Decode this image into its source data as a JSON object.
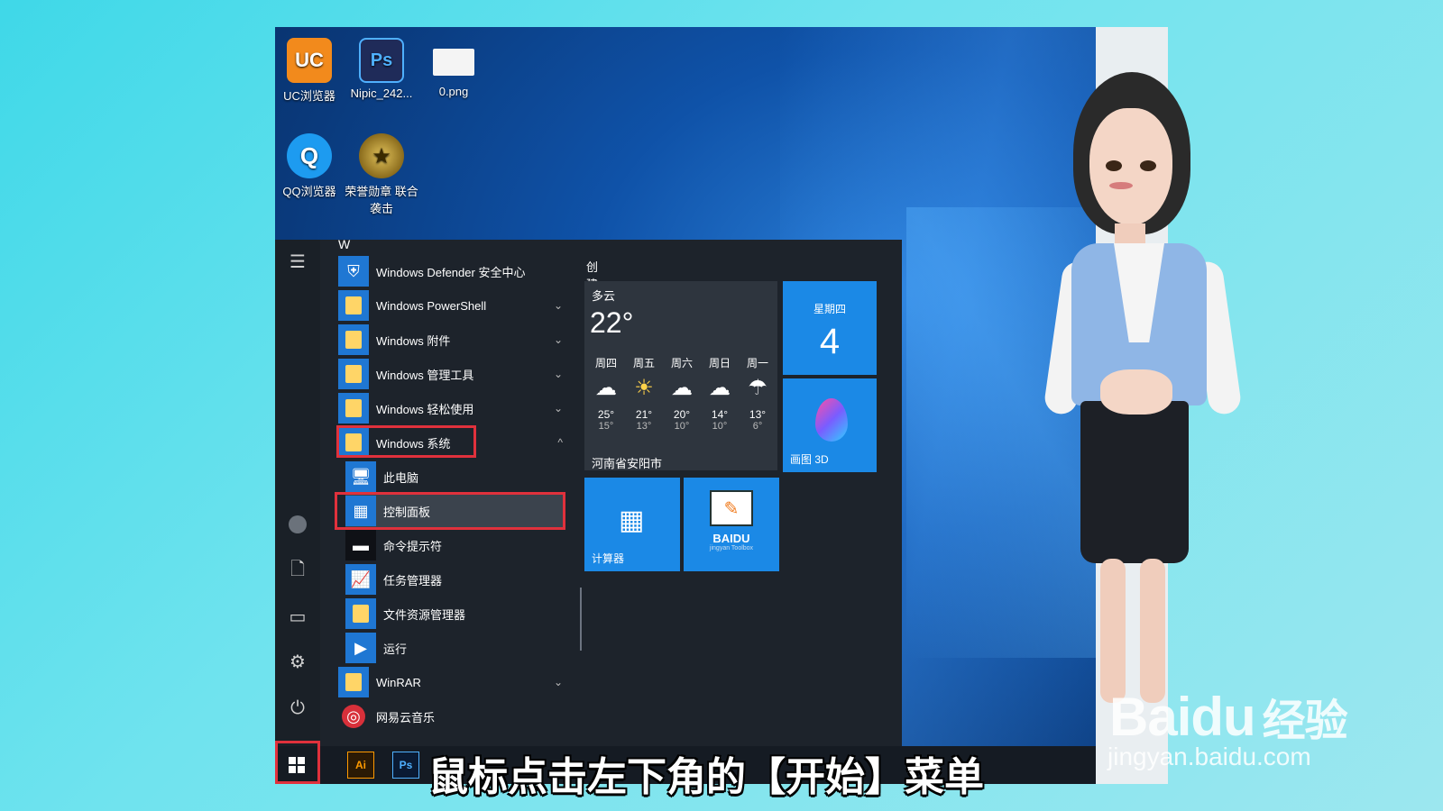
{
  "desktop": {
    "icons": [
      {
        "label": "UC浏览器",
        "glyph": "UC"
      },
      {
        "label": "Nipic_242...",
        "glyph": "Ps"
      },
      {
        "label": "0.png",
        "glyph": ""
      },
      {
        "label": "QQ浏览器",
        "glyph": "Q"
      },
      {
        "label": "荣誉勋章 联合袭击",
        "glyph": "★"
      }
    ]
  },
  "start_menu": {
    "section_letter": "W",
    "apps": [
      {
        "label": "Windows Defender 安全中心",
        "icon": "shield-icon",
        "expandable": false
      },
      {
        "label": "Windows PowerShell",
        "icon": "folder-icon",
        "expandable": true,
        "chevron": "⌄"
      },
      {
        "label": "Windows 附件",
        "icon": "folder-icon",
        "expandable": true,
        "chevron": "⌄"
      },
      {
        "label": "Windows 管理工具",
        "icon": "folder-icon",
        "expandable": true,
        "chevron": "⌄"
      },
      {
        "label": "Windows 轻松使用",
        "icon": "folder-icon",
        "expandable": true,
        "chevron": "⌄"
      },
      {
        "label": "Windows 系统",
        "icon": "folder-icon",
        "expandable": true,
        "chevron": "^",
        "highlighted": true
      },
      {
        "label": "此电脑",
        "icon": "computer-icon",
        "sub": true
      },
      {
        "label": "控制面板",
        "icon": "control-panel-icon",
        "sub": true,
        "selected": true,
        "highlighted": true
      },
      {
        "label": "命令提示符",
        "icon": "terminal-icon",
        "sub": true
      },
      {
        "label": "任务管理器",
        "icon": "task-manager-icon",
        "sub": true
      },
      {
        "label": "文件资源管理器",
        "icon": "folder-explorer-icon",
        "sub": true
      },
      {
        "label": "运行",
        "icon": "run-icon",
        "sub": true
      },
      {
        "label": "WinRAR",
        "icon": "folder-icon",
        "expandable": true,
        "chevron": "⌄"
      },
      {
        "label": "网易云音乐",
        "icon": "netease-music-icon"
      }
    ],
    "rail_icons": [
      "hamburger-icon",
      "user-icon",
      "document-icon",
      "pictures-icon",
      "settings-icon",
      "power-icon"
    ],
    "tiles": {
      "group_title": "创建",
      "weather": {
        "condition": "多云",
        "temperature": "22°",
        "location": "河南省安阳市",
        "forecast": [
          {
            "day": "周四",
            "icon": "cloud-icon",
            "high": "25°",
            "low": "15°"
          },
          {
            "day": "周五",
            "icon": "sun-icon",
            "high": "21°",
            "low": "13°"
          },
          {
            "day": "周六",
            "icon": "cloud-icon",
            "high": "20°",
            "low": "10°"
          },
          {
            "day": "周日",
            "icon": "cloud-icon",
            "high": "14°",
            "low": "10°"
          },
          {
            "day": "周一",
            "icon": "rain-icon",
            "high": "13°",
            "low": "6°"
          }
        ]
      },
      "calendar": {
        "weekday": "星期四",
        "day": "4"
      },
      "paint3d": {
        "label": "画图 3D"
      },
      "calculator": {
        "label": "计算器"
      },
      "baidu": {
        "label": "BAIDU",
        "sublabel": "jingyan Toolbox"
      }
    }
  },
  "taskbar": {
    "apps": [
      {
        "name": "illustrator",
        "label": "Ai"
      },
      {
        "name": "photoshop",
        "label": "Ps"
      }
    ]
  },
  "watermark": {
    "brand": "Baidu",
    "brand_cn": "经验",
    "url": "jingyan.baidu.com"
  },
  "caption": "鼠标点击左下角的【开始】菜单",
  "colors": {
    "accent": "#1b89e6",
    "highlight_red": "#e0313c",
    "menu_bg": "#1d232b"
  }
}
